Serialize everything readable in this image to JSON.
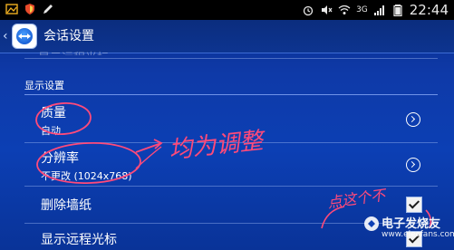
{
  "status_bar": {
    "time": "22:44",
    "network": "3G",
    "left_icons": [
      "picture-icon",
      "shield-icon",
      "pencil-icon"
    ],
    "right_icons": [
      "alarm-icon",
      "mute-icon",
      "wifi-icon",
      "signal-icon",
      "battery-icon"
    ]
  },
  "action_bar": {
    "title": "会话设置",
    "back_glyph": "‹"
  },
  "faded_row": "显示远程光标",
  "section": {
    "header": "显示设置"
  },
  "rows": [
    {
      "title": "质量",
      "subtitle": "自动",
      "control": "chevron"
    },
    {
      "title": "分辨率",
      "subtitle": "不更改 (1024x768)",
      "control": "chevron"
    },
    {
      "title": "删除墙纸",
      "subtitle": "",
      "control": "checkbox",
      "checked": true
    },
    {
      "title": "显示远程光标",
      "subtitle": "",
      "control": "checkbox",
      "checked": true
    }
  ],
  "annotations": {
    "main_note": "均为调整",
    "side_note": "点这个不"
  },
  "watermark": {
    "title": "电子发烧友",
    "url": "www.elecfans.com"
  },
  "colors": {
    "background_top": "#0a2a8a",
    "background_bottom": "#093398",
    "annotation": "#ff4a7a",
    "divider": "#6f93e8"
  }
}
